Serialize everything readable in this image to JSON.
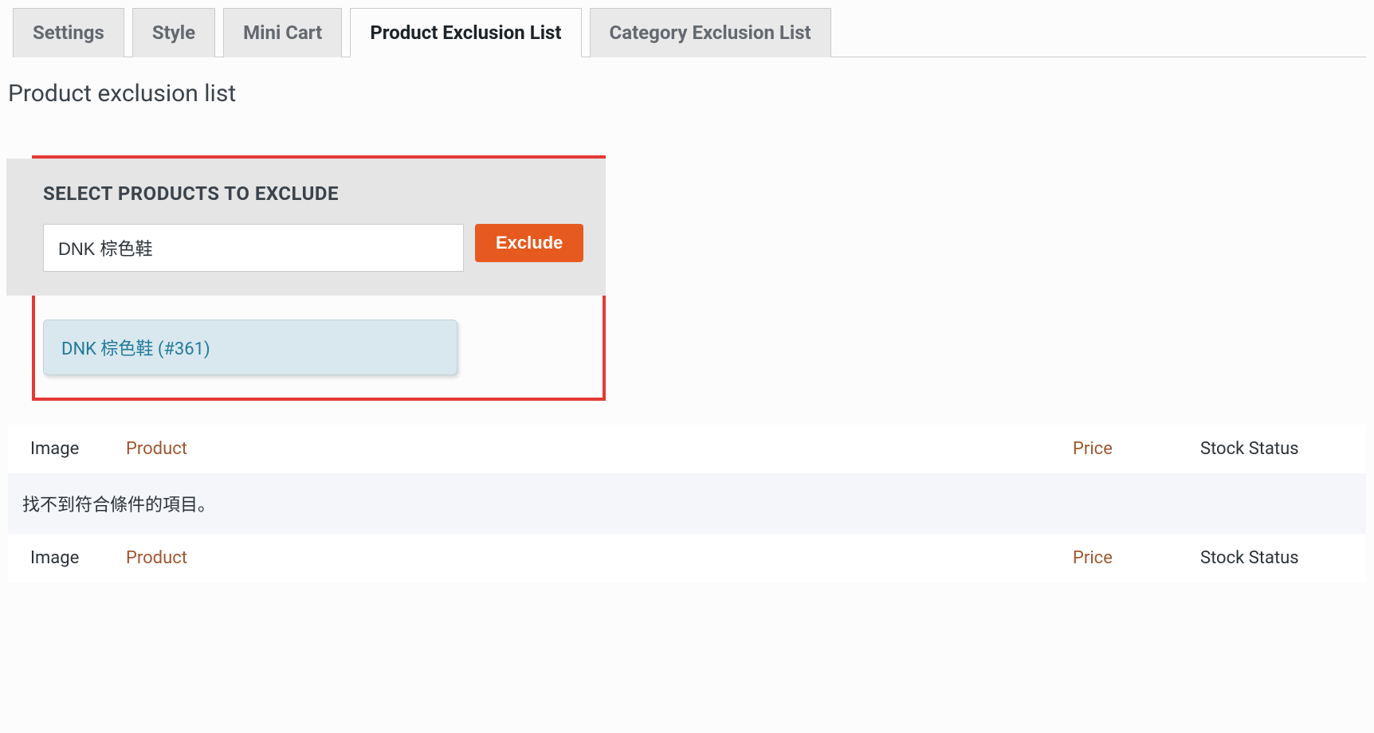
{
  "tabs": [
    {
      "label": "Settings",
      "active": false
    },
    {
      "label": "Style",
      "active": false
    },
    {
      "label": "Mini Cart",
      "active": false
    },
    {
      "label": "Product Exclusion List",
      "active": true
    },
    {
      "label": "Category Exclusion List",
      "active": false
    }
  ],
  "page_title": "Product exclusion list",
  "form": {
    "heading": "SELECT PRODUCTS TO EXCLUDE",
    "input_value": "DNK 棕色鞋",
    "exclude_label": "Exclude",
    "autocomplete": [
      {
        "label": "DNK 棕色鞋 (#361)"
      }
    ]
  },
  "table": {
    "headers": {
      "image": "Image",
      "product": "Product",
      "price": "Price",
      "stock_status": "Stock Status"
    },
    "empty_message": "找不到符合條件的項目。"
  }
}
